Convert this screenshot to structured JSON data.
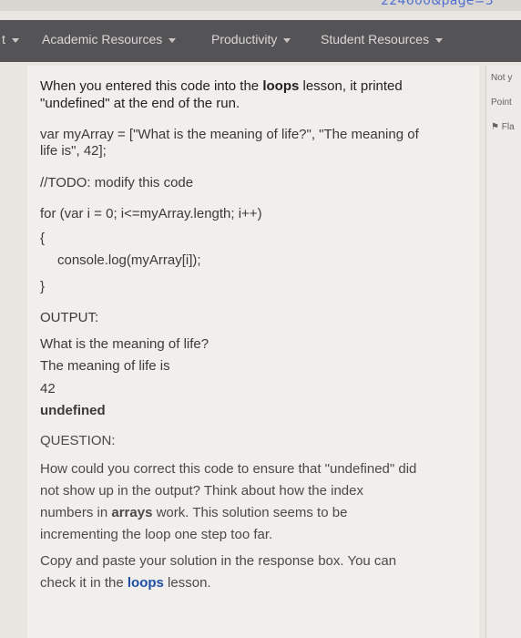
{
  "url": {
    "fragment": "224600&page=3"
  },
  "nav": {
    "left_stub": "t",
    "items": [
      "Academic Resources",
      "Productivity",
      "Student Resources"
    ]
  },
  "side": {
    "line1": "Not y",
    "line2": "Point",
    "line3": "Fla"
  },
  "content": {
    "intro1_a": "When you entered this code into the ",
    "intro1_b": "loops",
    "intro1_c": " lesson, it printed",
    "intro2": "\"undefined\" at the end of the run.",
    "code": [
      "var myArray = [\"What is the meaning of life?\", \"The meaning of",
      "life is\", 42];",
      "//TODO: modify this code",
      "for (var i = 0; i<=myArray.length; i++)",
      "{",
      "console.log(myArray[i]);",
      "}"
    ],
    "output_label": "OUTPUT:",
    "output": [
      "What is the meaning of life?",
      "The meaning of life is",
      "42"
    ],
    "output_last": "undefined",
    "question_label": "QUESTION:",
    "q1": "How could you correct this code to ensure that \"undefined\" did",
    "q2": "not show up in the output? Think about how the index",
    "q3_a": "numbers in ",
    "q3_b": "arrays",
    "q3_c": " work. This solution seems to be",
    "q4": "incrementing the loop one step too far.",
    "q5": "Copy and paste your solution in the response box. You can",
    "q6_a": "check it in the ",
    "q6_b": "loops",
    "q6_c": " lesson."
  }
}
